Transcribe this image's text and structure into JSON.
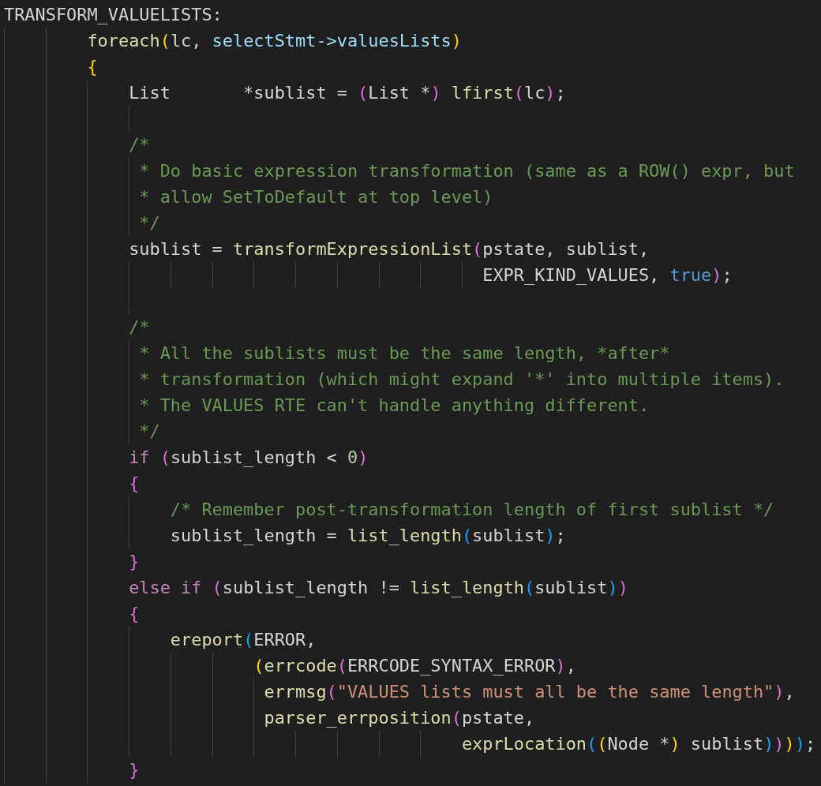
{
  "editor": {
    "lines": [
      {
        "kind": "code",
        "tokens": [
          {
            "text": "TRANSFORM_VALUELISTS:",
            "kind": "plain"
          }
        ]
      },
      {
        "kind": "code",
        "tokens": [
          {
            "text": "        foreach",
            "kind": "function"
          },
          {
            "text": "(",
            "kind": "bracket1"
          },
          {
            "text": "lc, ",
            "kind": "plain"
          },
          {
            "text": "selectStmt->valuesLists",
            "kind": "variable"
          },
          {
            "text": ")",
            "kind": "bracket1"
          }
        ]
      },
      {
        "kind": "code",
        "tokens": [
          {
            "text": "        {",
            "kind": "bracket1"
          }
        ]
      },
      {
        "kind": "code",
        "tokens": [
          {
            "text": "            List       *sublist = ",
            "kind": "plain"
          },
          {
            "text": "(",
            "kind": "bracket2"
          },
          {
            "text": "List *",
            "kind": "plain"
          },
          {
            "text": ") ",
            "kind": "bracket2"
          },
          {
            "text": "lfirst",
            "kind": "function"
          },
          {
            "text": "(",
            "kind": "bracket2"
          },
          {
            "text": "lc",
            "kind": "plain"
          },
          {
            "text": ")",
            "kind": "bracket2"
          },
          {
            "text": ";",
            "kind": "plain"
          }
        ]
      },
      {
        "kind": "blank"
      },
      {
        "kind": "code",
        "tokens": [
          {
            "text": "            /*",
            "kind": "comment"
          }
        ]
      },
      {
        "kind": "code",
        "tokens": [
          {
            "text": "             * Do basic expression transformation (same as a ROW() expr, but",
            "kind": "comment"
          }
        ]
      },
      {
        "kind": "code",
        "tokens": [
          {
            "text": "             * allow SetToDefault at top level)",
            "kind": "comment"
          }
        ]
      },
      {
        "kind": "code",
        "tokens": [
          {
            "text": "             */",
            "kind": "comment"
          }
        ]
      },
      {
        "kind": "code",
        "tokens": [
          {
            "text": "            sublist = ",
            "kind": "plain"
          },
          {
            "text": "transformExpressionList",
            "kind": "function"
          },
          {
            "text": "(",
            "kind": "bracket2"
          },
          {
            "text": "pstate, sublist,",
            "kind": "plain"
          }
        ]
      },
      {
        "kind": "code",
        "tokens": [
          {
            "text": "                                              EXPR_KIND_VALUES, ",
            "kind": "plain"
          },
          {
            "text": "true",
            "kind": "constant"
          },
          {
            "text": ")",
            "kind": "bracket2"
          },
          {
            "text": ";",
            "kind": "plain"
          }
        ]
      },
      {
        "kind": "blank"
      },
      {
        "kind": "code",
        "tokens": [
          {
            "text": "            /*",
            "kind": "comment"
          }
        ]
      },
      {
        "kind": "code",
        "tokens": [
          {
            "text": "             * All the sublists must be the same length, *after*",
            "kind": "comment"
          }
        ]
      },
      {
        "kind": "code",
        "tokens": [
          {
            "text": "             * transformation (which might expand '*' into multiple items).",
            "kind": "comment"
          }
        ]
      },
      {
        "kind": "code",
        "tokens": [
          {
            "text": "             * The VALUES RTE can't handle anything different.",
            "kind": "comment"
          }
        ]
      },
      {
        "kind": "code",
        "tokens": [
          {
            "text": "             */",
            "kind": "comment"
          }
        ]
      },
      {
        "kind": "code",
        "tokens": [
          {
            "text": "            if ",
            "kind": "keyword"
          },
          {
            "text": "(",
            "kind": "bracket2"
          },
          {
            "text": "sublist_length < ",
            "kind": "plain"
          },
          {
            "text": "0",
            "kind": "number"
          },
          {
            "text": ")",
            "kind": "bracket2"
          }
        ]
      },
      {
        "kind": "code",
        "tokens": [
          {
            "text": "            {",
            "kind": "bracket2"
          }
        ]
      },
      {
        "kind": "code",
        "tokens": [
          {
            "text": "                /* Remember post-transformation length of first sublist */",
            "kind": "comment"
          }
        ]
      },
      {
        "kind": "code",
        "tokens": [
          {
            "text": "                sublist_length = ",
            "kind": "plain"
          },
          {
            "text": "list_length",
            "kind": "function"
          },
          {
            "text": "(",
            "kind": "bracket3"
          },
          {
            "text": "sublist",
            "kind": "plain"
          },
          {
            "text": ")",
            "kind": "bracket3"
          },
          {
            "text": ";",
            "kind": "plain"
          }
        ]
      },
      {
        "kind": "code",
        "tokens": [
          {
            "text": "            }",
            "kind": "bracket2"
          }
        ]
      },
      {
        "kind": "code",
        "tokens": [
          {
            "text": "            else if ",
            "kind": "keyword"
          },
          {
            "text": "(",
            "kind": "bracket2"
          },
          {
            "text": "sublist_length != ",
            "kind": "plain"
          },
          {
            "text": "list_length",
            "kind": "function"
          },
          {
            "text": "(",
            "kind": "bracket3"
          },
          {
            "text": "sublist",
            "kind": "plain"
          },
          {
            "text": ")",
            "kind": "bracket3"
          },
          {
            "text": ")",
            "kind": "bracket2"
          }
        ]
      },
      {
        "kind": "code",
        "tokens": [
          {
            "text": "            {",
            "kind": "bracket2"
          }
        ]
      },
      {
        "kind": "code",
        "tokens": [
          {
            "text": "                ereport",
            "kind": "function"
          },
          {
            "text": "(",
            "kind": "bracket3"
          },
          {
            "text": "ERROR,",
            "kind": "plain"
          }
        ]
      },
      {
        "kind": "code",
        "tokens": [
          {
            "text": "                        (",
            "kind": "bracket1"
          },
          {
            "text": "errcode",
            "kind": "function"
          },
          {
            "text": "(",
            "kind": "bracket2"
          },
          {
            "text": "ERRCODE_SYNTAX_ERROR",
            "kind": "plain"
          },
          {
            "text": ")",
            "kind": "bracket2"
          },
          {
            "text": ",",
            "kind": "plain"
          }
        ]
      },
      {
        "kind": "code",
        "tokens": [
          {
            "text": "                         errmsg",
            "kind": "function"
          },
          {
            "text": "(",
            "kind": "bracket2"
          },
          {
            "text": "\"VALUES lists must all be the same length\"",
            "kind": "string"
          },
          {
            "text": ")",
            "kind": "bracket2"
          },
          {
            "text": ",",
            "kind": "plain"
          }
        ]
      },
      {
        "kind": "code",
        "tokens": [
          {
            "text": "                         parser_errposition",
            "kind": "function"
          },
          {
            "text": "(",
            "kind": "bracket2"
          },
          {
            "text": "pstate,",
            "kind": "plain"
          }
        ]
      },
      {
        "kind": "code",
        "tokens": [
          {
            "text": "                                            exprLocation",
            "kind": "function"
          },
          {
            "text": "(",
            "kind": "bracket3"
          },
          {
            "text": "(",
            "kind": "bracket1"
          },
          {
            "text": "Node *",
            "kind": "plain"
          },
          {
            "text": ")",
            "kind": "bracket1"
          },
          {
            "text": " sublist",
            "kind": "plain"
          },
          {
            "text": ")",
            "kind": "bracket3"
          },
          {
            "text": ")",
            "kind": "bracket2"
          },
          {
            "text": ")",
            "kind": "bracket1"
          },
          {
            "text": ")",
            "kind": "bracket3"
          },
          {
            "text": ";",
            "kind": "plain"
          }
        ]
      },
      {
        "kind": "code",
        "tokens": [
          {
            "text": "            }",
            "kind": "bracket2"
          }
        ]
      }
    ]
  }
}
